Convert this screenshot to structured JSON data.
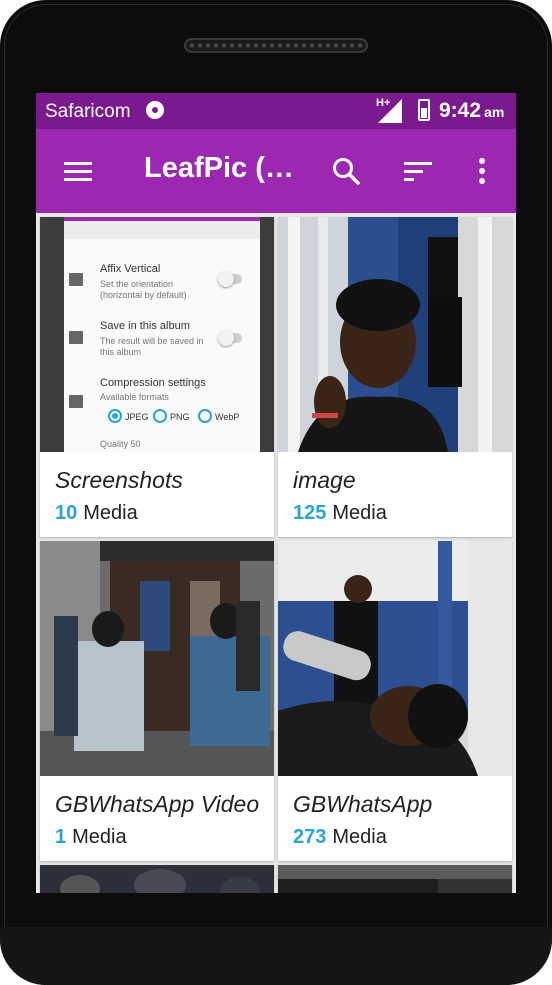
{
  "status_bar": {
    "carrier": "Safaricom",
    "network": "H+",
    "time": "9:42",
    "ampm": "am"
  },
  "toolbar": {
    "title": "LeafPic (…",
    "icons": [
      "menu-icon",
      "search-icon",
      "sort-icon",
      "more-vert-icon"
    ]
  },
  "albums": [
    {
      "name": "Screenshots",
      "count": "10",
      "count_label": "Media",
      "thumb_text": {
        "affix_title": "Affix Vertical",
        "affix_sub1": "Set the orientation",
        "affix_sub2": "(horizontal by default)",
        "save_title": "Save in this album",
        "save_sub1": "The result will be saved in",
        "save_sub2": "this album",
        "compression_title": "Compression settings",
        "compression_sub": "Available formats",
        "formats": [
          "JPEG",
          "PNG",
          "WebP"
        ],
        "quality": "Quality 50"
      }
    },
    {
      "name": "image",
      "count": "125",
      "count_label": "Media"
    },
    {
      "name": "GBWhatsApp Video",
      "count": "1",
      "count_label": "Media"
    },
    {
      "name": "GBWhatsApp",
      "count": "273",
      "count_label": "Media"
    }
  ],
  "colors": {
    "status_bar": "#7b1a8f",
    "toolbar": "#9c27b0",
    "count_accent": "#29a3e0"
  }
}
